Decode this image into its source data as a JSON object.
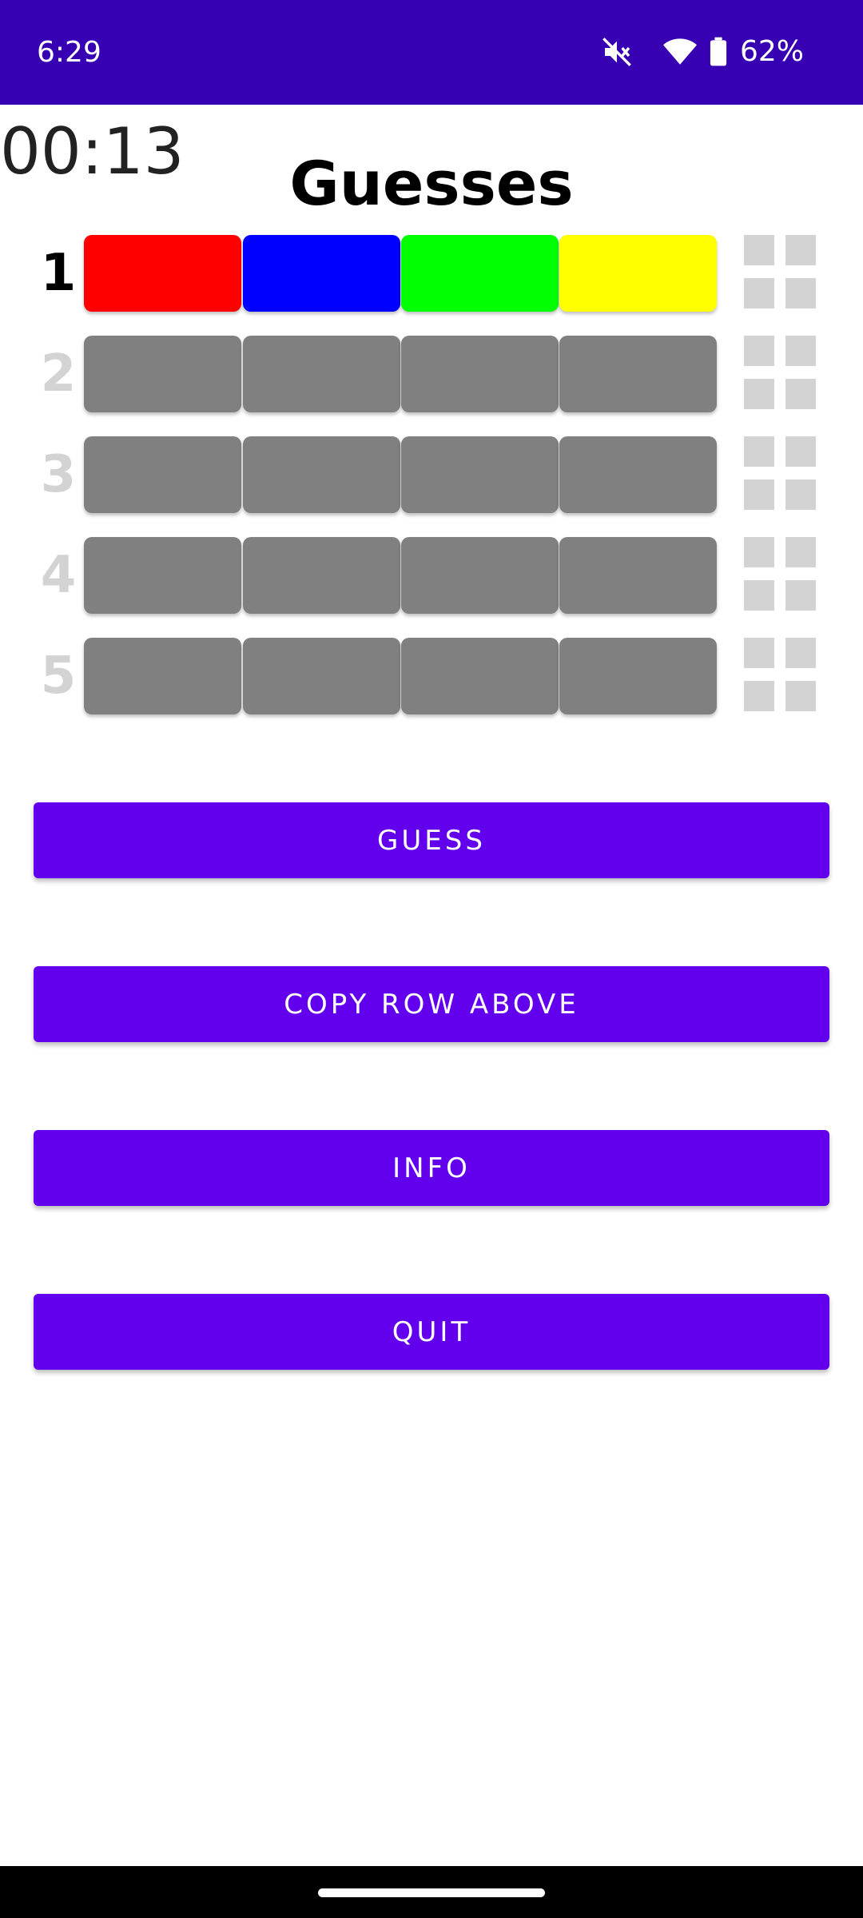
{
  "status_bar": {
    "time": "6:29",
    "icons": [
      "mute-icon",
      "wifi-icon",
      "battery-icon"
    ],
    "battery_percent": "62%",
    "background": "#3700b3"
  },
  "timer": "00:13",
  "title": "Guesses",
  "rows": [
    {
      "number": "1",
      "active": true,
      "pegs": [
        "#ff0000",
        "#0000ff",
        "#00ff00",
        "#ffff00"
      ]
    },
    {
      "number": "2",
      "active": false,
      "pegs": [
        "#808080",
        "#808080",
        "#808080",
        "#808080"
      ]
    },
    {
      "number": "3",
      "active": false,
      "pegs": [
        "#808080",
        "#808080",
        "#808080",
        "#808080"
      ]
    },
    {
      "number": "4",
      "active": false,
      "pegs": [
        "#808080",
        "#808080",
        "#808080",
        "#808080"
      ]
    },
    {
      "number": "5",
      "active": false,
      "pegs": [
        "#808080",
        "#808080",
        "#808080",
        "#808080"
      ]
    }
  ],
  "buttons": {
    "guess": "GUESS",
    "copy_row_above": "COPY ROW ABOVE",
    "info": "INFO",
    "quit": "QUIT",
    "color": "#6200ee"
  }
}
